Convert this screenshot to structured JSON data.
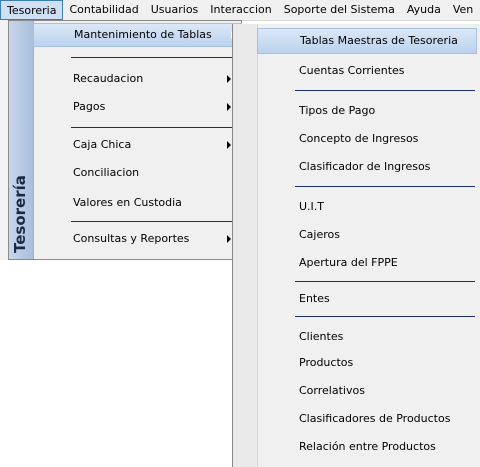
{
  "menubar": {
    "items": [
      "Tesoreria",
      "Contabilidad",
      "Usuarios",
      "Interaccion",
      "Soporte del Sistema",
      "Ayuda",
      "Ven"
    ]
  },
  "sidebar": {
    "label": "Tesorería"
  },
  "menu1": {
    "items": [
      "Mantenimiento de Tablas",
      "Recaudacion",
      "Pagos",
      "Caja Chica",
      "Conciliacion",
      "Valores en Custodia",
      "Consultas y Reportes"
    ]
  },
  "menu2": {
    "items": [
      "Tablas Maestras de Tesoreria",
      "Cuentas Corrientes",
      "Tipos de Pago",
      "Concepto de Ingresos",
      "Clasificador de Ingresos",
      "U.I.T",
      "Cajeros",
      "Apertura del FPPE",
      "Entes",
      "Clientes",
      "Productos",
      "Correlativos",
      "Clasificadores de Productos",
      "Relación entre Productos"
    ]
  },
  "colors": {
    "highlight": "#bcd2ee",
    "separator": "#1e2f6e",
    "sidebar": "#a9bfdc"
  },
  "icons": [
    "submenu-arrow-icon"
  ]
}
